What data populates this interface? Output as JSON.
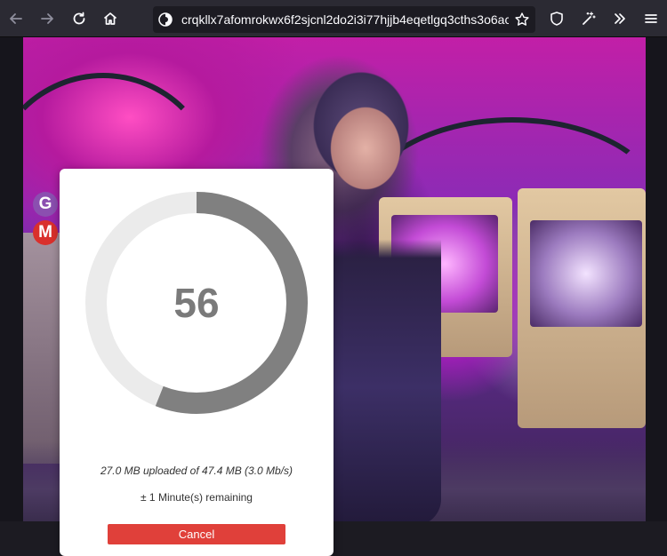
{
  "browser": {
    "url": "crqkllx7afomrokwx6f2sjcnl2do2i3i77hjjb4eqetlgq3cths3o6ac",
    "icons": {
      "back": "back-arrow-icon",
      "forward": "forward-arrow-icon",
      "reload": "reload-icon",
      "home": "home-icon",
      "site": "tor-onion-icon",
      "bookmark": "star-icon",
      "shield": "shield-icon",
      "extensions": "magic-wand-icon",
      "overflow": "chevron-double-right-icon",
      "menu": "hamburger-menu-icon"
    }
  },
  "sidebar": {
    "badges": [
      {
        "letter": "G",
        "color": "#8b4fb0",
        "icon": "g-badge-icon"
      },
      {
        "letter": "M",
        "color": "#d9302c",
        "icon": "m-badge-icon"
      }
    ]
  },
  "upload": {
    "percent": 56,
    "percent_label": "56",
    "stats_text": "27.0 MB uploaded of 47.4 MB (3.0 Mb/s)",
    "remaining_text": "± 1 Minute(s) remaining",
    "cancel_label": "Cancel",
    "colors": {
      "track": "#ebebeb",
      "progress": "#808080",
      "cancel": "#e0403a"
    }
  }
}
